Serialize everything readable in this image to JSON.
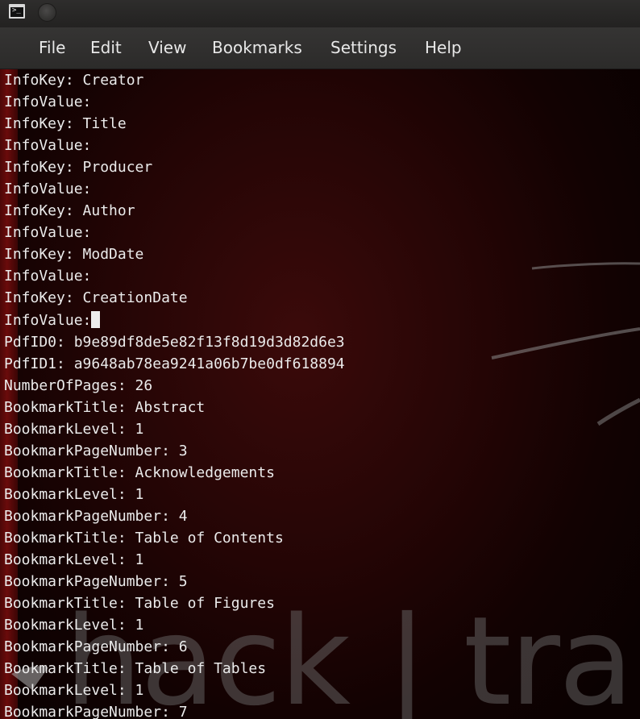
{
  "menu": [
    "File",
    "Edit",
    "View",
    "Bookmarks",
    "Settings",
    "Help"
  ],
  "terminal": {
    "lines": [
      "InfoKey: Creator",
      "InfoValue:",
      "InfoKey: Title",
      "InfoValue:",
      "InfoKey: Producer",
      "InfoValue:",
      "InfoKey: Author",
      "InfoValue:",
      "InfoKey: ModDate",
      "InfoValue:",
      "InfoKey: CreationDate",
      "InfoValue:",
      "PdfID0: b9e89df8de5e82f13f8d19d3d82d6e3",
      "PdfID1: a9648ab78ea9241a06b7be0df618894",
      "NumberOfPages: 26",
      "BookmarkTitle: Abstract",
      "BookmarkLevel: 1",
      "BookmarkPageNumber: 3",
      "BookmarkTitle: Acknowledgements",
      "BookmarkLevel: 1",
      "BookmarkPageNumber: 4",
      "BookmarkTitle: Table of Contents",
      "BookmarkLevel: 1",
      "BookmarkPageNumber: 5",
      "BookmarkTitle: Table of Figures",
      "BookmarkLevel: 1",
      "BookmarkPageNumber: 6",
      "BookmarkTitle: Table of Tables",
      "BookmarkLevel: 1",
      "BookmarkPageNumber: 7"
    ],
    "cursor_line": 11
  },
  "wallpaper": {
    "watermark": "hack | tra",
    "accent_color": "#6a0b0b"
  },
  "icons": {
    "app": "terminal-icon",
    "window_button": "window-menu-icon"
  }
}
